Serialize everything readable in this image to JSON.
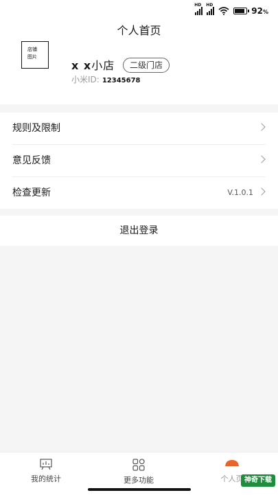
{
  "status_bar": {
    "battery": "92",
    "battery_unit": "%",
    "signal_1_label": "HD",
    "signal_2_label": "HD",
    "icons": [
      "signal-icon",
      "signal-icon",
      "wifi-icon",
      "battery-icon"
    ]
  },
  "header": {
    "title": "个人首页",
    "store_image_line1": "店铺",
    "store_image_line2": "图片",
    "store_name_prefix": "x x",
    "store_name_suffix": "小店",
    "level_badge": "二级门店",
    "id_label": "小米ID:",
    "id_value": "12345678"
  },
  "menu": {
    "items": [
      {
        "label": "规则及限制",
        "value": ""
      },
      {
        "label": "意见反馈",
        "value": ""
      },
      {
        "label": "检查更新",
        "value": "V.1.0.1"
      }
    ]
  },
  "logout": {
    "label": "退出登录"
  },
  "tabbar": {
    "tabs": [
      {
        "label": "我的统计",
        "icon": "chart-board-icon"
      },
      {
        "label": "更多功能",
        "icon": "grid-icon"
      },
      {
        "label": "个人页",
        "icon": "person-icon"
      }
    ]
  },
  "watermark": {
    "text": "神奇下载"
  },
  "colors": {
    "accent": "#e8642c",
    "background": "#f5f5f5",
    "card": "#ffffff",
    "watermark": "#1e8e3e"
  }
}
